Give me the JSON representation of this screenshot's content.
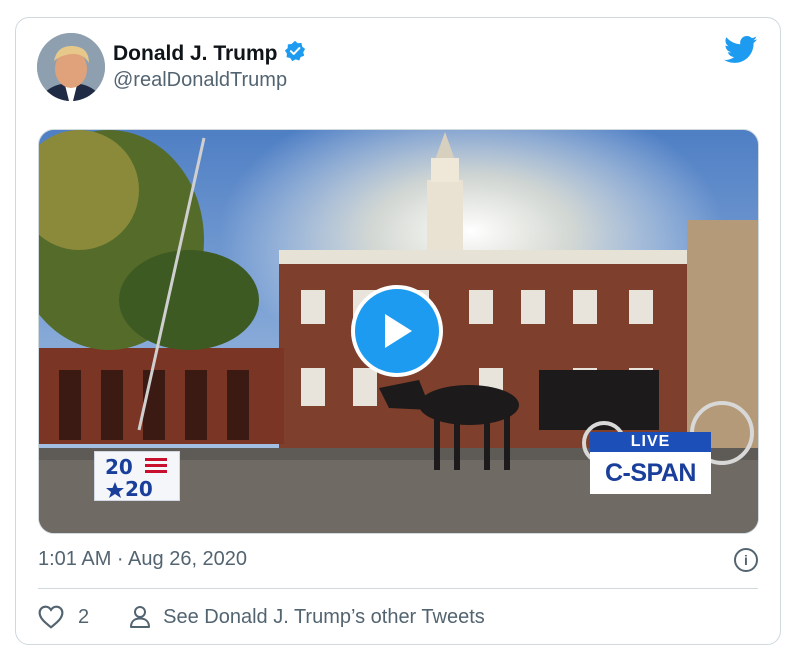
{
  "tweet": {
    "author_name": "Donald J. Trump",
    "handle": "@realDonaldTrump",
    "timestamp": "1:01 AM · Aug 26, 2020",
    "like_count": "2",
    "other_tweets_label": "See Donald J. Trump’s other Tweets"
  },
  "video": {
    "logo_2020_top": "20",
    "logo_2020_bottom": "20",
    "live_label": "LIVE",
    "channel_label": "C-SPAN"
  },
  "icons": {
    "verified": "verified-badge-icon",
    "twitter": "twitter-bird-icon",
    "play": "play-icon",
    "info": "info-icon",
    "like": "heart-icon",
    "profile": "person-icon"
  },
  "colors": {
    "twitter_blue": "#1d9bf0",
    "text_secondary": "#536471",
    "border": "#cfd9de",
    "cspan_blue": "#1a3f9a"
  }
}
